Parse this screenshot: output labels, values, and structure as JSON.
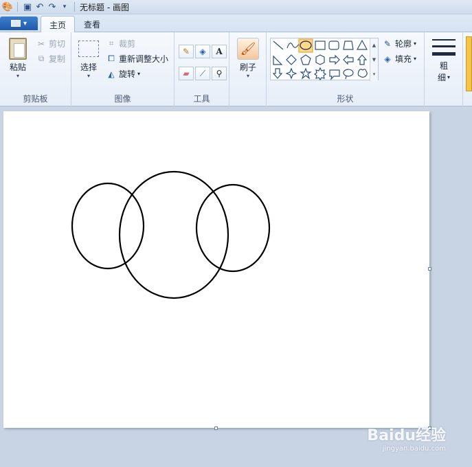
{
  "window": {
    "title": "无标题 - 画图"
  },
  "tabs": [
    {
      "label": "主页"
    },
    {
      "label": "查看"
    }
  ],
  "ribbon": {
    "clipboard": {
      "group_label": "剪贴板",
      "paste": "粘贴",
      "cut": "剪切",
      "copy": "复制"
    },
    "image": {
      "group_label": "图像",
      "select": "选择",
      "crop": "裁剪",
      "resize": "重新调整大小",
      "rotate": "旋转"
    },
    "tools": {
      "group_label": "工具",
      "text_tool": "A"
    },
    "brushes": {
      "label": "刷子"
    },
    "shapes": {
      "group_label": "形状",
      "outline": "轮廓",
      "fill": "填充"
    },
    "size": {
      "label_line1": "粗",
      "label_line2": "细"
    }
  },
  "canvas": {
    "ellipses_desc": "three overlapping black outlined ellipses"
  },
  "watermark": {
    "text": "Baidu经验",
    "sub": "jingyan.baidu.com"
  }
}
